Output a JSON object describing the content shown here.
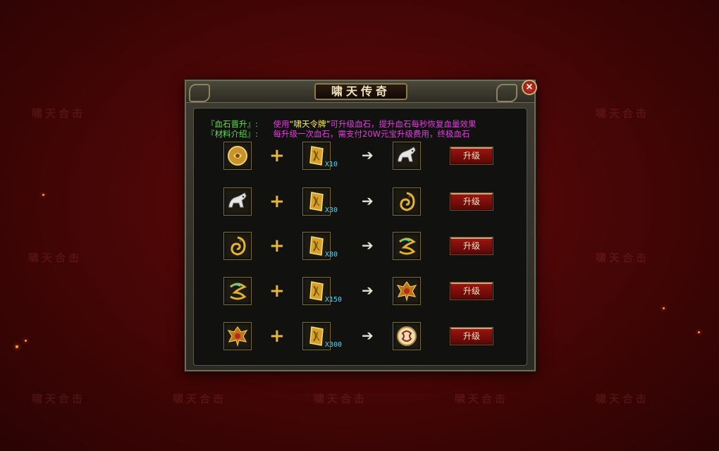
{
  "watermark_text": "啸天合击",
  "dialog": {
    "title": "啸天传奇",
    "close_label": "×"
  },
  "info": {
    "line1": {
      "tag": "『血石晋升』:",
      "pre": "使用",
      "highlight": "“啸天令牌”",
      "post": "可升级血石，提升血石每秒恢复血量效果"
    },
    "line2": {
      "tag": "『材料介绍』:",
      "text": "每升级一次血石，需支付20W元宝升级费用，终极血石"
    }
  },
  "upgrade_button_label": "升级",
  "rows": [
    {
      "from_icon": "gold-round-stone-icon",
      "material_icon": "token-plaque-icon",
      "qty": "X10",
      "to_icon": "silver-beast-icon"
    },
    {
      "from_icon": "silver-beast-icon",
      "material_icon": "token-plaque-icon",
      "qty": "X30",
      "to_icon": "gold-dragon-icon"
    },
    {
      "from_icon": "gold-dragon-icon",
      "material_icon": "token-plaque-icon",
      "qty": "X80",
      "to_icon": "jade-dragon-icon"
    },
    {
      "from_icon": "jade-dragon-icon",
      "material_icon": "token-plaque-icon",
      "qty": "X150",
      "to_icon": "demon-mask-icon"
    },
    {
      "from_icon": "demon-mask-icon",
      "material_icon": "token-plaque-icon",
      "qty": "X300",
      "to_icon": "ultimate-disc-icon"
    }
  ],
  "colors": {
    "tag": "#5fe04a",
    "text": "#e53be0",
    "highlight": "#fff14a",
    "qty": "#4ad7ff",
    "plus": "#e6b63c"
  }
}
